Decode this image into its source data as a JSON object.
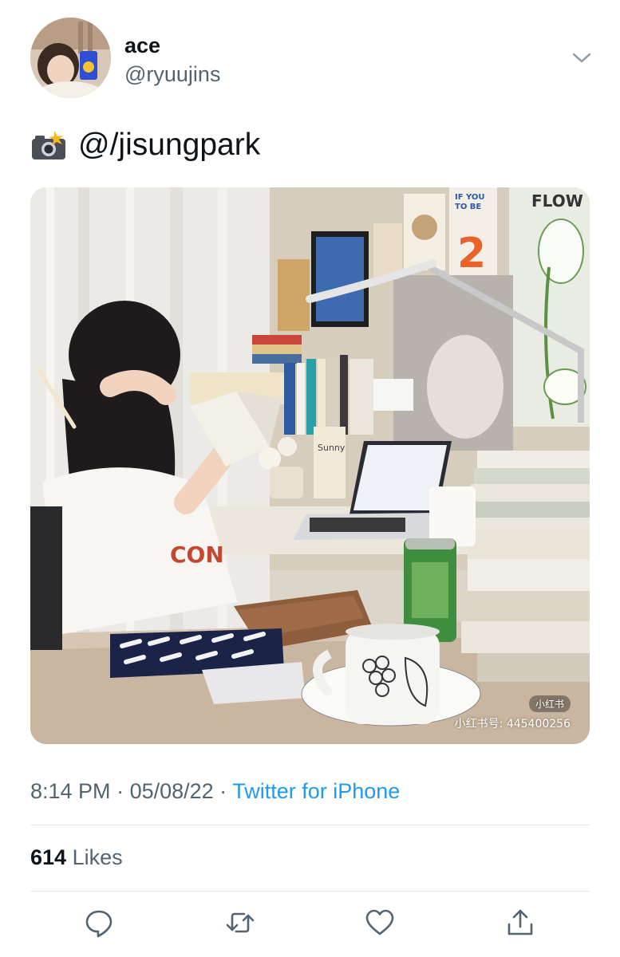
{
  "author": {
    "display_name": "ace",
    "handle": "@ryuujins"
  },
  "tweet": {
    "text": "@/jisungpark",
    "text_icon": "camera-flash-icon"
  },
  "media": {
    "watermark_badge": "小红书",
    "watermark_id": "小红书号: 445400256",
    "poster_text_1": "FLOW",
    "poster_text_2": "IF YOU",
    "poster_text_3": "TO BE",
    "poster_number": "2",
    "book_cover_text": "Sunny",
    "shirt_text": "CON"
  },
  "meta": {
    "time": "8:14 PM",
    "separator": " · ",
    "date": "05/08/22",
    "source": "Twitter for iPhone"
  },
  "stats": {
    "likes_count": "614",
    "likes_label": "Likes"
  },
  "actions": [
    "reply-icon",
    "retweet-icon",
    "like-icon",
    "share-icon"
  ],
  "colors": {
    "text_primary": "#0f1419",
    "text_secondary": "#536471",
    "accent": "#1d9bf0",
    "divider": "#e6e6e6"
  }
}
